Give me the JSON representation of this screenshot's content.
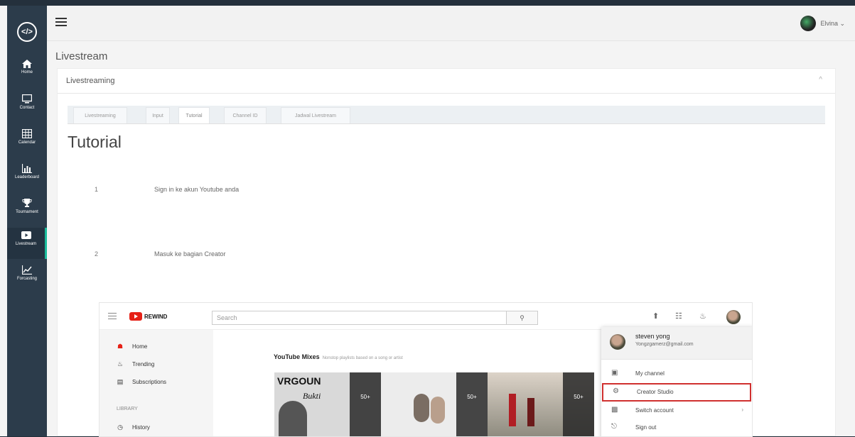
{
  "sidebar": {
    "logo": "</>",
    "items": [
      {
        "label": "Home",
        "icon": "home-icon"
      },
      {
        "label": "Contact",
        "icon": "monitor-icon"
      },
      {
        "label": "Calendar",
        "icon": "calendar-icon"
      },
      {
        "label": "Leaderboard",
        "icon": "bar-chart-icon"
      },
      {
        "label": "Tournament",
        "icon": "trophy-icon"
      },
      {
        "label": "Livestream",
        "icon": "play-icon",
        "active": true
      },
      {
        "label": "Forcasting",
        "icon": "line-chart-icon"
      }
    ]
  },
  "topbar": {
    "user_name": "Elvina ⌄"
  },
  "page": {
    "title": "Livestream"
  },
  "card": {
    "header": "Livestreaming",
    "collapse_icon": "^",
    "tabs": [
      "Livestreaming",
      "Input",
      "Tutorial",
      "Channel ID",
      "Jadwal Livestream"
    ],
    "active_tab": "Tutorial"
  },
  "tutorial": {
    "heading": "Tutorial",
    "steps": [
      {
        "num": "1",
        "text": "Sign in ke akun Youtube anda"
      },
      {
        "num": "2",
        "text": "Masuk ke bagian Creator"
      }
    ]
  },
  "youtube": {
    "logo_text": "REWIND",
    "search_placeholder": "Search",
    "nav": [
      "Home",
      "Trending",
      "Subscriptions"
    ],
    "library_label": "LIBRARY",
    "library_items": [
      "History"
    ],
    "mixes_title": "YouTube Mixes",
    "mixes_subtitle": "Nonstop playlists based on a song or artist",
    "thumb_count": "50+",
    "thumb_text": "VRGOUN",
    "thumb_sub": "Bukti",
    "menu": {
      "user_name": "steven yong",
      "user_email": "Yongzgamerz@gmail.com",
      "items": [
        "My channel",
        "Creator Studio",
        "Switch account",
        "Sign out"
      ],
      "highlighted": "Creator Studio"
    }
  },
  "colors": {
    "sidebar_bg": "#2c3c4b",
    "accent": "#1abc9c",
    "youtube_red": "#e62117",
    "highlight": "#d0302f"
  }
}
